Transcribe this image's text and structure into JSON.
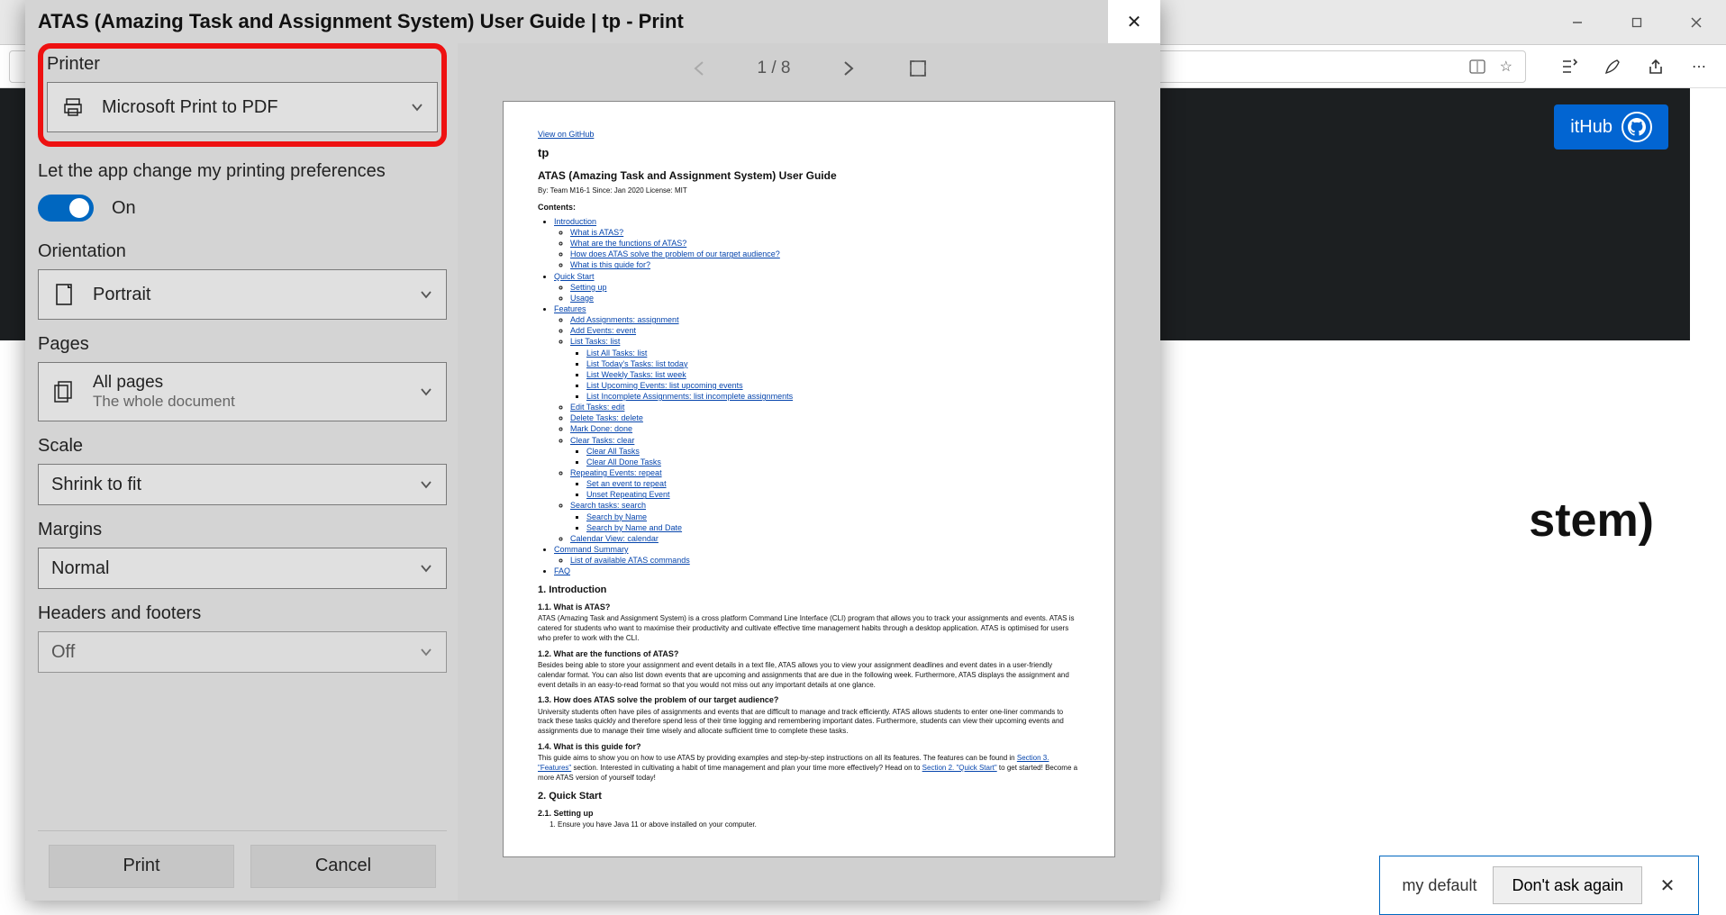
{
  "browser": {
    "behind_partial_title": "stem)",
    "github_btn": "itHub",
    "default_banner": {
      "my_default": "my default",
      "dont_ask": "Don't ask again"
    }
  },
  "dialog": {
    "title": "ATAS (Amazing Task and Assignment System) User Guide | tp - Print",
    "printer_label": "Printer",
    "printer_value": "Microsoft Print to PDF",
    "pref_label": "Let the app change my printing preferences",
    "pref_on": "On",
    "orientation_label": "Orientation",
    "orientation_value": "Portrait",
    "pages_label": "Pages",
    "pages_value": "All pages",
    "pages_sub": "The whole document",
    "scale_label": "Scale",
    "scale_value": "Shrink to fit",
    "margins_label": "Margins",
    "margins_value": "Normal",
    "headers_label": "Headers and footers",
    "headers_value": "Off",
    "print_btn": "Print",
    "cancel_btn": "Cancel",
    "pager": "1  /  8"
  },
  "doc": {
    "view_on_github": "View on GitHub",
    "tp": "tp",
    "title": "ATAS (Amazing Task and Assignment System) User Guide",
    "meta": "By: Team M16-1 Since: Jan 2020 License: MIT",
    "contents": "Contents:",
    "sect1": "1. Introduction",
    "s11": "1.1. What is ATAS?",
    "p11": "ATAS (Amazing Task and Assignment System) is a cross platform Command Line Interface (CLI) program that allows you to track your assignments and events. ATAS is catered for students who want to maximise their productivity and cultivate effective time management habits through a desktop application. ATAS is optimised for users who prefer to work with the CLI.",
    "s12": "1.2. What are the functions of ATAS?",
    "p12": "Besides being able to store your assignment and event details in a text file, ATAS allows you to view your assignment deadlines and event dates in a user-friendly calendar format. You can also list down events that are upcoming and assignments that are due in the following week. Furthermore, ATAS displays the assignment and event details in an easy-to-read format so that you would not miss out any important details at one glance.",
    "s13": "1.3. How does ATAS solve the problem of our target audience?",
    "p13": "University students often have piles of assignments and events that are difficult to manage and track efficiently. ATAS allows students to enter one-liner commands to track these tasks quickly and therefore spend less of their time logging and remembering important dates. Furthermore, students can view their upcoming events and assignments due to manage their time wisely and allocate sufficient time to complete these tasks.",
    "s14": "1.4. What is this guide for?",
    "p14a": "This guide aims to show you on how to use ATAS by providing examples and step-by-step instructions on all its features. The features can be found in ",
    "p14l1": "Section 3. \"Features\"",
    "p14b": " section. Interested in cultivating a habit of time management and plan your time more effectively? Head on to ",
    "p14l2": "Section 2. \"Quick Start\"",
    "p14c": " to get started! Become a more ATAS version of yourself today!",
    "sect2": "2. Quick Start",
    "s21": "2.1. Setting up",
    "ol1": "Ensure you have Java 11 or above installed on your computer.",
    "toc": {
      "intro": "Introduction",
      "what": "What is ATAS?",
      "func": "What are the functions of ATAS?",
      "solve": "How does ATAS solve the problem of our target audience?",
      "guide": "What is this guide for?",
      "qs": "Quick Start",
      "setup": "Setting up",
      "usage": "Usage",
      "feat": "Features",
      "add_assign": "Add Assignments: assignment",
      "add_events": "Add Events: event",
      "list_tasks": "List Tasks: list",
      "list_all": "List All Tasks: list",
      "list_today": "List Today's Tasks: list today",
      "list_week": "List Weekly Tasks: list week",
      "list_upcoming": "List Upcoming Events: list upcoming events",
      "list_incomplete": "List Incomplete Assignments: list incomplete assignments",
      "edit": "Edit Tasks: edit",
      "delete": "Delete Tasks: delete",
      "done": "Mark Done: done",
      "clear": "Clear Tasks: clear",
      "clear_all": "Clear All Tasks",
      "clear_done": "Clear All Done Tasks",
      "repeat": "Repeating Events: repeat",
      "set_repeat": "Set an event to repeat",
      "unset_repeat": "Unset Repeating Event",
      "search": "Search tasks: search",
      "search_name": "Search by Name",
      "search_date": "Search by Name and Date",
      "calendar": "Calendar View: calendar",
      "cmd_summary": "Command Summary",
      "cmd_list": "List of available ATAS commands",
      "faq": "FAQ"
    }
  }
}
